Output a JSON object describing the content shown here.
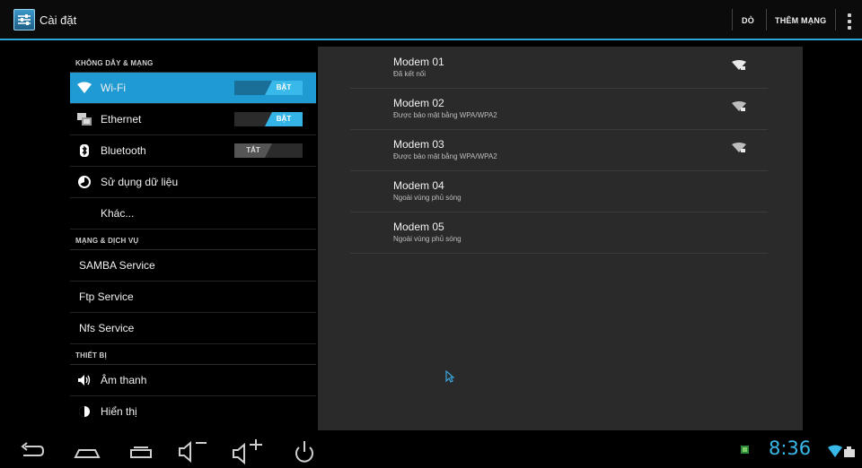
{
  "app": {
    "title": "Cài đặt"
  },
  "actions": {
    "scan": "DÒ",
    "add_network": "THÊM MẠNG"
  },
  "sections": {
    "wireless": "KHÔNG DÂY & MẠNG",
    "network_services": "MẠNG & DỊCH VỤ",
    "device": "THIẾT BỊ"
  },
  "menu": {
    "wifi": {
      "label": "Wi-Fi",
      "toggle": "BẬT"
    },
    "ethernet": {
      "label": "Ethernet",
      "toggle": "BẬT"
    },
    "bluetooth": {
      "label": "Bluetooth",
      "toggle": "TẮT"
    },
    "data_usage": {
      "label": "Sử dụng dữ liệu"
    },
    "more": {
      "label": "Khác..."
    },
    "samba": {
      "label": "SAMBA Service"
    },
    "ftp": {
      "label": "Ftp Service"
    },
    "nfs": {
      "label": "Nfs Service"
    },
    "sound": {
      "label": "Âm thanh"
    },
    "display": {
      "label": "Hiển thị"
    }
  },
  "networks": [
    {
      "name": "Modem 01",
      "status": "Đã kết nối",
      "icon": "wifi-secured-icon"
    },
    {
      "name": "Modem 02",
      "status": "Được bảo mật bằng WPA/WPA2",
      "icon": "wifi-secured-icon"
    },
    {
      "name": "Modem 03",
      "status": "Được bảo mật bằng WPA/WPA2",
      "icon": "wifi-secured-icon"
    },
    {
      "name": "Modem 04",
      "status": "Ngoài vùng phủ sóng"
    },
    {
      "name": "Modem 05",
      "status": "Ngoài vùng phủ sóng"
    }
  ],
  "status_bar": {
    "time": "8:36"
  },
  "colors": {
    "accent": "#2aa5d6",
    "active_item": "#1f9ad2",
    "clock": "#39b8ea"
  }
}
